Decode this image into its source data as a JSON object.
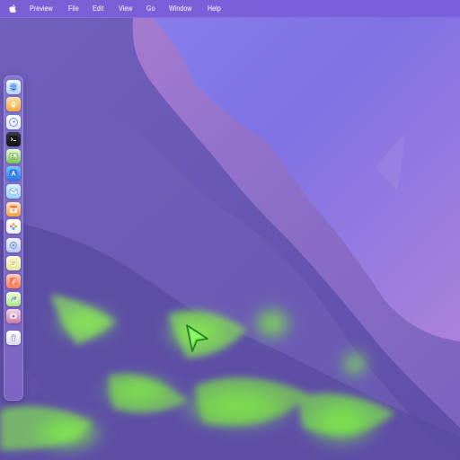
{
  "menubar": {
    "apple_icon": "apple-logo-icon",
    "items": [
      {
        "label": "Preview"
      },
      {
        "label": "File"
      },
      {
        "label": "Edit"
      },
      {
        "label": "View"
      },
      {
        "label": "Go"
      },
      {
        "label": "Window"
      },
      {
        "label": "Help"
      }
    ]
  },
  "dock": {
    "items": [
      {
        "name": "finder-icon"
      },
      {
        "name": "launchpad-icon"
      },
      {
        "name": "safari-icon"
      },
      {
        "name": "terminal-icon"
      },
      {
        "name": "preview-icon"
      },
      {
        "name": "app-store-icon"
      },
      {
        "name": "mail-icon"
      },
      {
        "name": "calendar-icon"
      },
      {
        "name": "photos-icon"
      },
      {
        "name": "settings-icon"
      },
      {
        "name": "notes-icon"
      },
      {
        "name": "music-icon"
      },
      {
        "name": "maps-icon"
      },
      {
        "name": "trash-icon"
      }
    ]
  },
  "colors": {
    "wallpaper_sky": "#7f7ae8",
    "wallpaper_ridge": "#9b72cb",
    "wallpaper_hill": "#6e5fb8",
    "wallpaper_grass": "#7fe74b",
    "menubar_text": "#f7f2ff",
    "cursor": "#6af03f"
  }
}
